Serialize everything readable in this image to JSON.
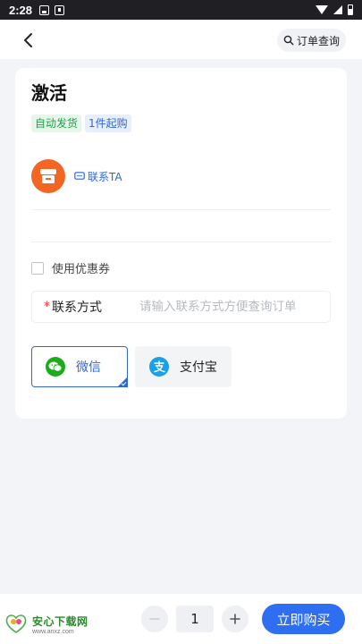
{
  "status_bar": {
    "time": "2:28"
  },
  "header": {
    "order_query_label": "订单查询"
  },
  "product": {
    "title": "激活",
    "tags": [
      "自动发货",
      "1件起购"
    ]
  },
  "seller": {
    "contact_label": "联系TA"
  },
  "coupon": {
    "label": "使用优惠券"
  },
  "contact_field": {
    "required_mark": "*",
    "label": "联系方式",
    "placeholder": "请输入联系方式方便查询订单",
    "value": ""
  },
  "payment": {
    "options": [
      {
        "label": "微信",
        "selected": true,
        "icon": "wechat-icon",
        "color": "#1aad19"
      },
      {
        "label": "支付宝",
        "selected": false,
        "icon": "alipay-icon",
        "color": "#1aa0e6"
      }
    ]
  },
  "bottom_bar": {
    "quantity": "1",
    "buy_label": "立即购买",
    "accent": "#2e6ef0"
  },
  "watermark": {
    "title": "安心下载网",
    "url": "www.anxz.com"
  }
}
